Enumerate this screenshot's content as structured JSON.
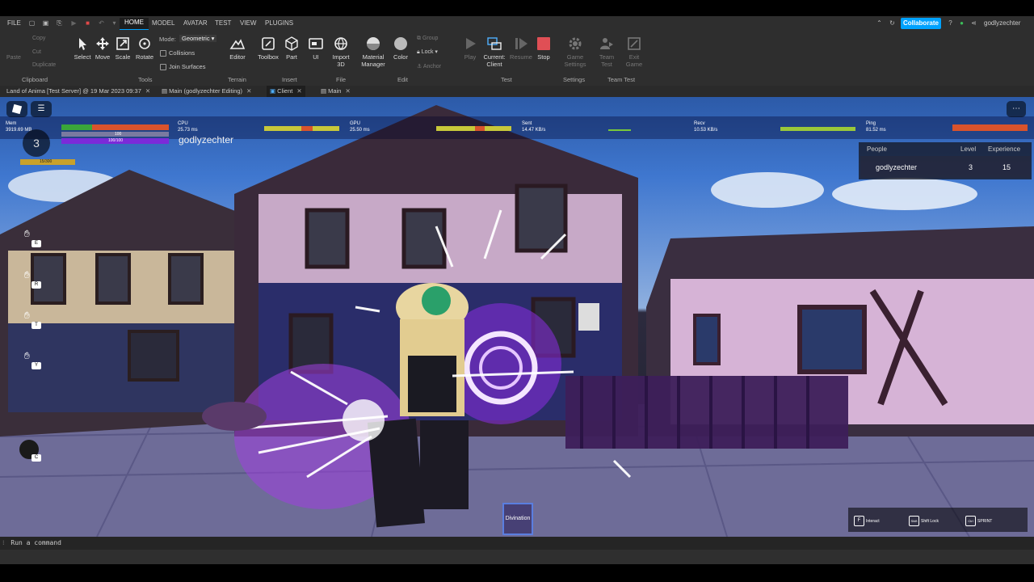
{
  "menubar": {
    "file": "FILE",
    "tabs": [
      "HOME",
      "MODEL",
      "AVATAR",
      "TEST",
      "VIEW",
      "PLUGINS"
    ],
    "active_tab": "HOME",
    "collaborate": "Collaborate",
    "username": "godlyzechter"
  },
  "ribbon": {
    "clipboard": {
      "paste": "Paste",
      "copy": "Copy",
      "cut": "Cut",
      "duplicate": "Duplicate",
      "label": "Clipboard"
    },
    "tools": {
      "select": "Select",
      "move": "Move",
      "scale": "Scale",
      "rotate": "Rotate",
      "mode_label": "Mode:",
      "mode_value": "Geometric",
      "collisions": "Collisions",
      "join_surfaces": "Join Surfaces",
      "label": "Tools"
    },
    "terrain": {
      "editor": "Editor",
      "label": "Terrain"
    },
    "insert": {
      "toolbox": "Toolbox",
      "part": "Part",
      "ui": "UI",
      "label": "Insert"
    },
    "file": {
      "import3d": "Import 3D",
      "label": "File"
    },
    "edit": {
      "material_manager": "Material Manager",
      "color": "Color",
      "group": "Group",
      "lock": "Lock",
      "anchor": "Anchor",
      "label": "Edit"
    },
    "test": {
      "play": "Play",
      "current_client": "Current: Client",
      "resume": "Resume",
      "stop": "Stop",
      "label": "Test"
    },
    "settings": {
      "game_settings": "Game Settings",
      "label": "Settings"
    },
    "team_test": {
      "team_test": "Team Test",
      "exit_game": "Exit Game",
      "label": "Team Test"
    }
  },
  "doc_tabs": [
    {
      "label": "Land of Anima [Test Server] @ 19 Mar 2023 09:37"
    },
    {
      "label": "Main (godlyzechter Editing)"
    },
    {
      "label": "Client"
    },
    {
      "label": "Main"
    }
  ],
  "hud": {
    "mem_label": "Mem",
    "mem_value": "3919.69 MB",
    "cpu_label": "CPU",
    "cpu_value": "25.73 ms",
    "gpu_label": "GPU",
    "gpu_value": "25.50 ms",
    "sent_label": "Sent",
    "sent_value": "14.47 KB/s",
    "recv_label": "Recv",
    "recv_value": "10.53 KB/s",
    "ping_label": "Ping",
    "ping_value": "81.52 ms",
    "level": "3",
    "player_name": "godlyzechter",
    "bar_mana": "100",
    "bar_stamina": "100/100",
    "xp_text": "15/300"
  },
  "people": {
    "header_people": "People",
    "header_level": "Level",
    "header_experience": "Experience",
    "rows": [
      {
        "name": "godlyzechter",
        "level": "3",
        "experience": "15"
      }
    ]
  },
  "ability_keys": [
    "E",
    "R",
    "T",
    "Y",
    "C"
  ],
  "hotbar": {
    "slot1": "Divination"
  },
  "controls": {
    "interact_key": "F",
    "interact": "Interact",
    "shift_key": "Shift",
    "shift_lock": "Shift Lock",
    "sprint_key": "Ctrl",
    "sprint": "SPRINT"
  },
  "command_bar": {
    "placeholder": "Run a command"
  },
  "colors": {
    "accent": "#00a2ff",
    "health": "#d9532c",
    "health_green": "#3aa63a",
    "mana": "#7b2ad9",
    "xp": "#c8a12a",
    "magic": "#b14dff"
  }
}
